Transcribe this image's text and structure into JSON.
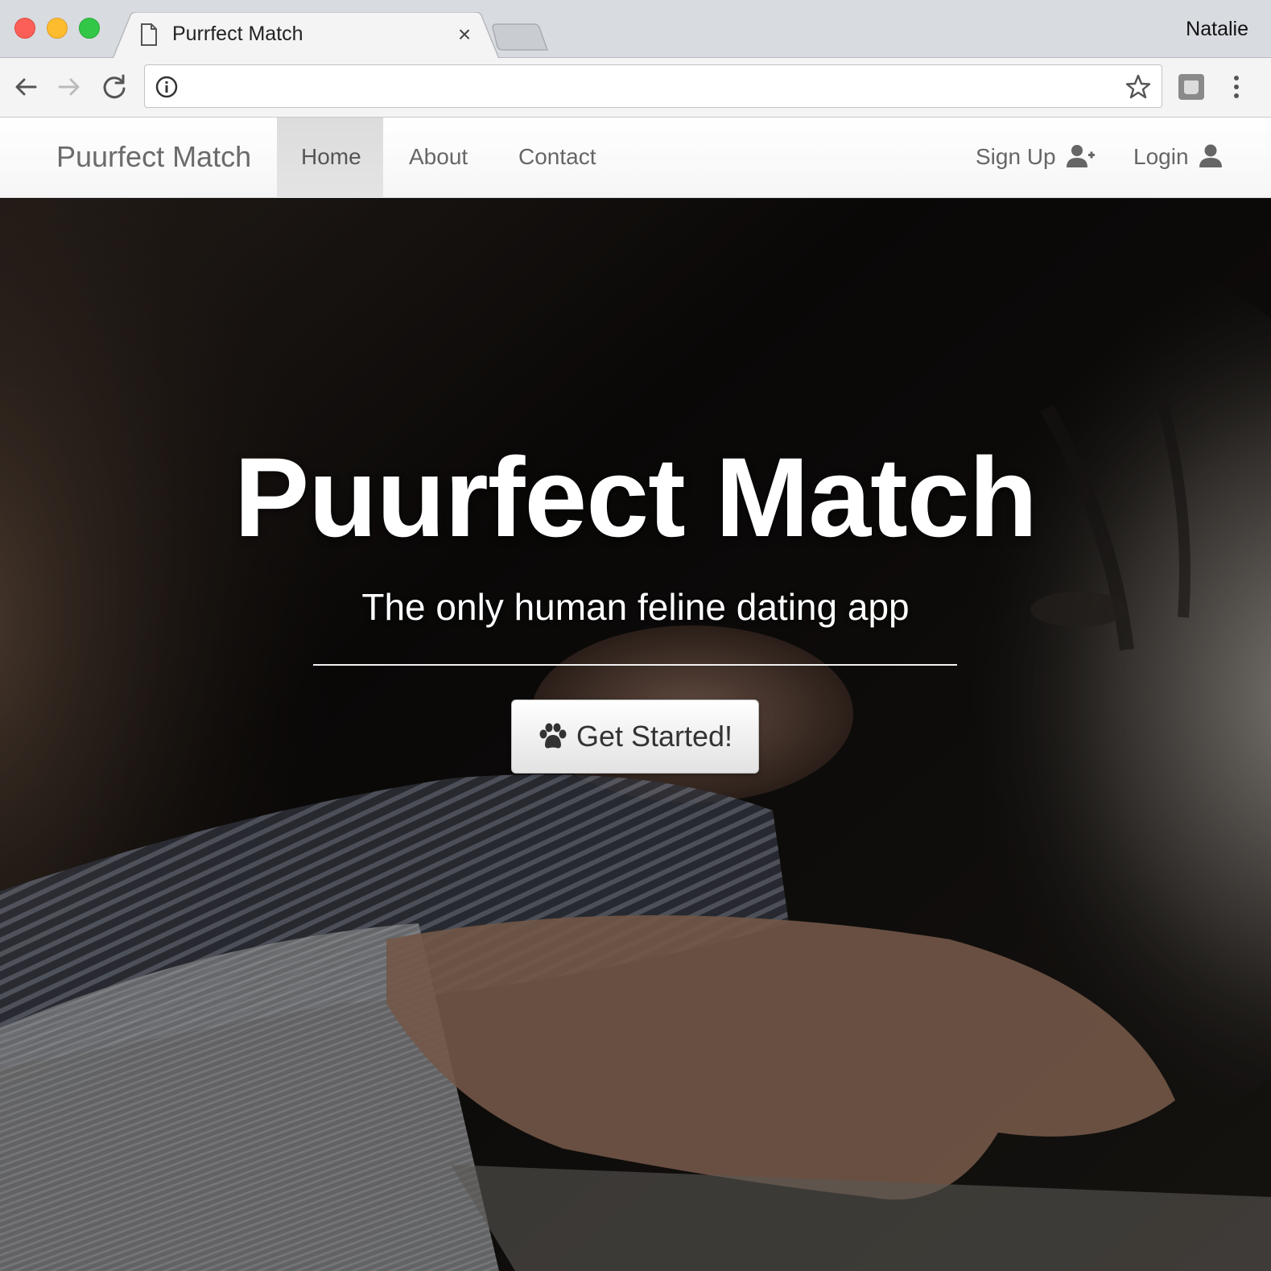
{
  "browser": {
    "tab_title": "Purrfect Match",
    "tab_close_glyph": "×",
    "profile_name": "Natalie",
    "address_value": "",
    "icons": [
      "document-icon",
      "back-arrow-icon",
      "forward-arrow-icon",
      "reload-icon",
      "info-icon",
      "star-icon",
      "extension-icon",
      "menu-icon"
    ]
  },
  "navbar": {
    "brand": "Puurfect Match",
    "items": [
      {
        "label": "Home",
        "active": true
      },
      {
        "label": "About",
        "active": false
      },
      {
        "label": "Contact",
        "active": false
      }
    ],
    "right_items": [
      {
        "label": "Sign Up",
        "icon": "user-plus-icon"
      },
      {
        "label": "Login",
        "icon": "user-icon"
      }
    ]
  },
  "hero": {
    "title": "Puurfect Match",
    "subtitle": "The only human feline dating app",
    "cta_label": "Get Started!",
    "cta_icon": "paw-icon"
  },
  "colors": {
    "nav_text": "#666666",
    "nav_active_bg": "#e0e0e0",
    "hero_text": "#ffffff",
    "traffic_red": "#fc5f57",
    "traffic_yellow": "#fdbc2e",
    "traffic_green": "#33c748"
  }
}
